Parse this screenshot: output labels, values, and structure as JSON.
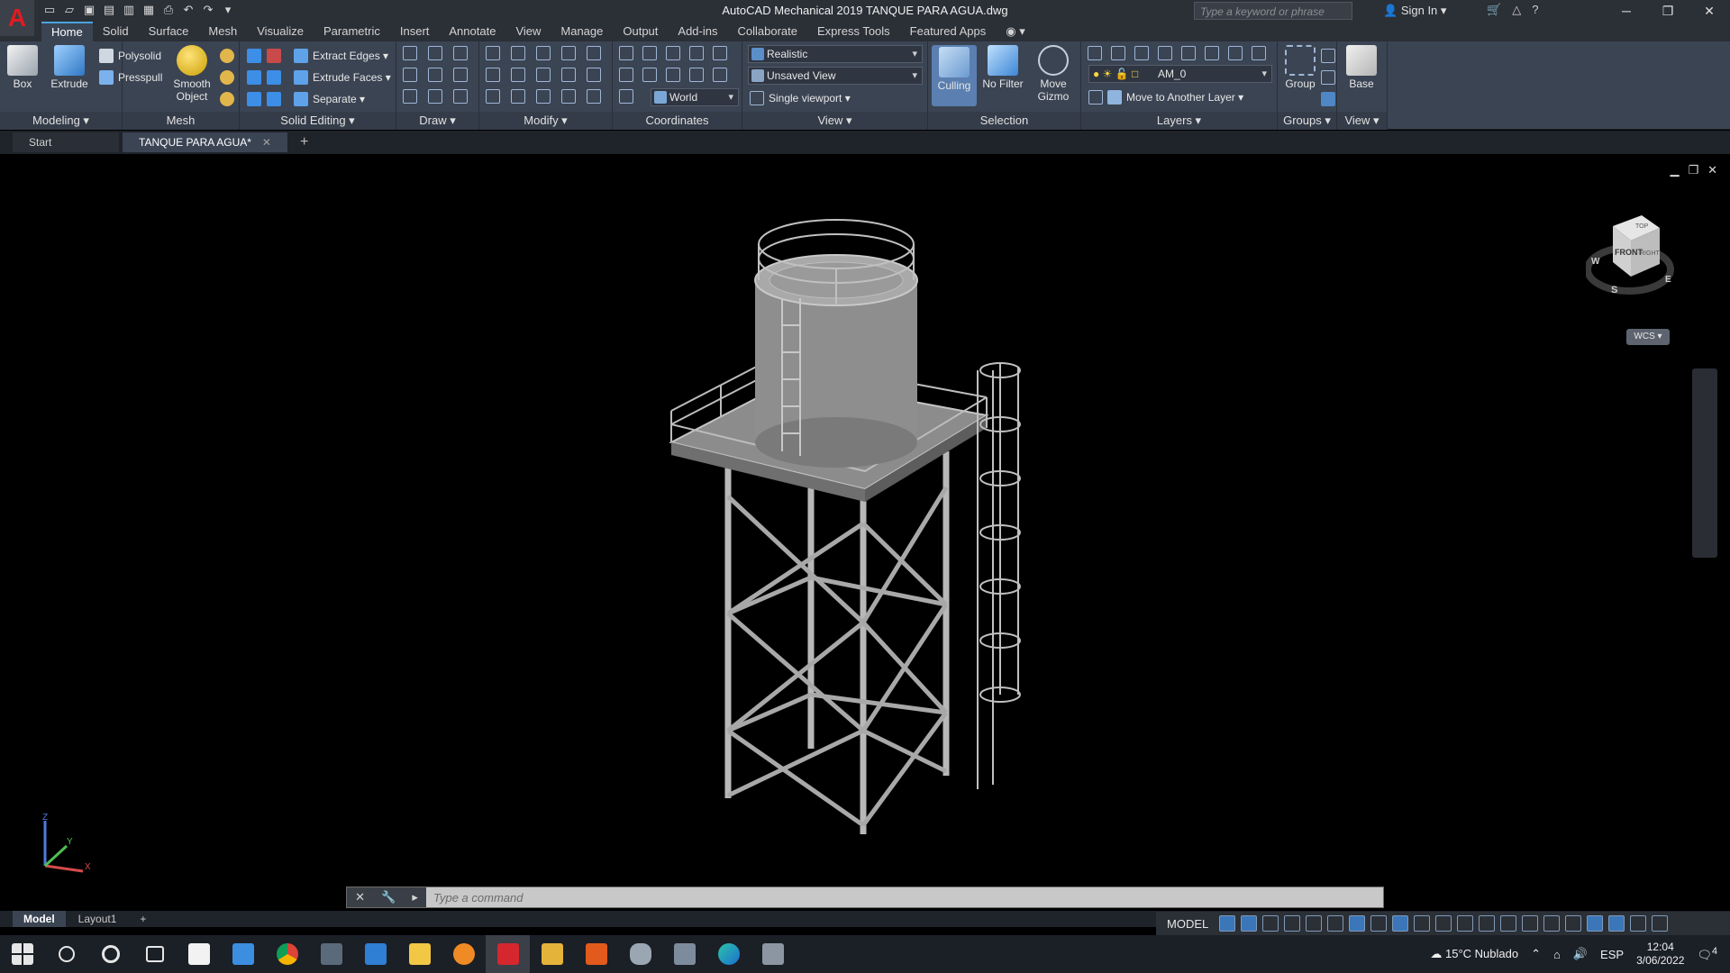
{
  "titlebar": {
    "title": "AutoCAD Mechanical 2019   TANQUE PARA AGUA.dwg",
    "search_placeholder": "Type a keyword or phrase",
    "sign_in": "Sign In",
    "app_logo": "A"
  },
  "ribbon_tabs": [
    "Home",
    "Solid",
    "Surface",
    "Mesh",
    "Visualize",
    "Parametric",
    "Insert",
    "Annotate",
    "View",
    "Manage",
    "Output",
    "Add-ins",
    "Collaborate",
    "Express Tools",
    "Featured Apps"
  ],
  "ribbon": {
    "modeling": {
      "title": "Modeling ▾",
      "box": "Box",
      "extrude": "Extrude",
      "polysolid": "Polysolid",
      "presspull": "Presspull"
    },
    "mesh": {
      "title": "Mesh",
      "smooth": "Smooth Object"
    },
    "solid_editing": {
      "title": "Solid Editing ▾",
      "extract_edges": "Extract Edges ▾",
      "extrude_faces": "Extrude Faces ▾",
      "separate": "Separate ▾"
    },
    "draw": {
      "title": "Draw ▾"
    },
    "modify": {
      "title": "Modify ▾"
    },
    "coordinates": {
      "title": "Coordinates",
      "world": "World"
    },
    "view": {
      "title": "View ▾",
      "visual_style": "Realistic",
      "named_view": "Unsaved View",
      "viewport": "Single viewport ▾"
    },
    "selection": {
      "title": "Selection",
      "culling": "Culling",
      "no_filter": "No Filter",
      "move_gizmo": "Move Gizmo"
    },
    "layers": {
      "title": "Layers ▾",
      "layer_name": "AM_0",
      "move_layer": "Move to Another Layer ▾"
    },
    "groups": {
      "title": "Groups ▾",
      "group": "Group"
    },
    "view2": {
      "title": "View ▾",
      "base": "Base"
    }
  },
  "doc_tabs": {
    "start": "Start",
    "active": "TANQUE PARA AGUA*"
  },
  "viewcube": {
    "top": "TOP",
    "front": "FRONT",
    "right": "RIGHT",
    "w": "W",
    "s": "S",
    "e": "E",
    "wcs": "WCS ▾"
  },
  "ucs": {
    "x": "X",
    "y": "Y",
    "z": "Z"
  },
  "command": {
    "placeholder": "Type a command"
  },
  "layout_tabs": [
    "Model",
    "Layout1"
  ],
  "status": {
    "model": "MODEL"
  },
  "taskbar": {
    "weather": "15°C  Nublado",
    "lang": "ESP",
    "time": "12:04",
    "date": "3/06/2022",
    "notif": "4"
  }
}
